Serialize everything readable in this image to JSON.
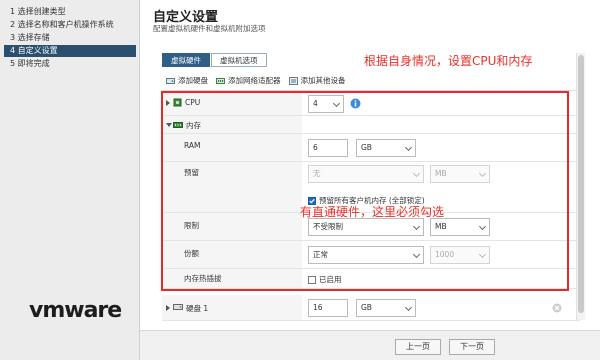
{
  "wizard": {
    "steps": [
      {
        "label": "1 选择创建类型",
        "state": "completed"
      },
      {
        "label": "2 选择名称和客户机操作系统",
        "state": "completed"
      },
      {
        "label": "3 选择存储",
        "state": "completed"
      },
      {
        "label": "4 自定义设置",
        "state": "active"
      },
      {
        "label": "5 即将完成",
        "state": "pending"
      }
    ],
    "logo": "vmware"
  },
  "page": {
    "title": "自定义设置",
    "subtitle": "配置虚拟机硬件和虚拟机附加选项"
  },
  "annotations": {
    "top": "根据自身情况，设置CPU和内存",
    "middle": "有直通硬件，这里必须勾选",
    "color": "#e8312a"
  },
  "tabs": [
    {
      "label": "虚拟硬件",
      "active": true
    },
    {
      "label": "虚拟机选项",
      "active": false
    }
  ],
  "toolbar": {
    "add_disk": "添加硬盘",
    "add_nic": "添加网络适配器",
    "add_other": "添加其他设备"
  },
  "hardware": {
    "cpu": {
      "label": "CPU",
      "value": "4",
      "info_icon": "info-icon"
    },
    "memory": {
      "label": "内存",
      "ram": {
        "label": "RAM",
        "value": "6",
        "unit": "GB"
      },
      "reservation": {
        "label": "预留",
        "value": "无",
        "unit": "MB"
      },
      "reserve_all": {
        "label": "预留所有客户机内存 (全部锁定)",
        "checked": true
      },
      "limit": {
        "label": "限制",
        "value": "不受限制",
        "unit": "MB"
      },
      "shares": {
        "label": "份额",
        "value": "正常",
        "amount": "1000"
      },
      "hot_plug": {
        "label": "内存热插拔",
        "option": "已启用",
        "checked": false
      }
    },
    "disk1": {
      "label": "硬盘 1",
      "value": "16",
      "unit": "GB"
    }
  },
  "footer": {
    "back": "上一页",
    "next": "下一页"
  },
  "colors": {
    "active_step": "#2b4f6e",
    "active_tab": "#2f5f86",
    "red_box": "#e62a2a"
  }
}
